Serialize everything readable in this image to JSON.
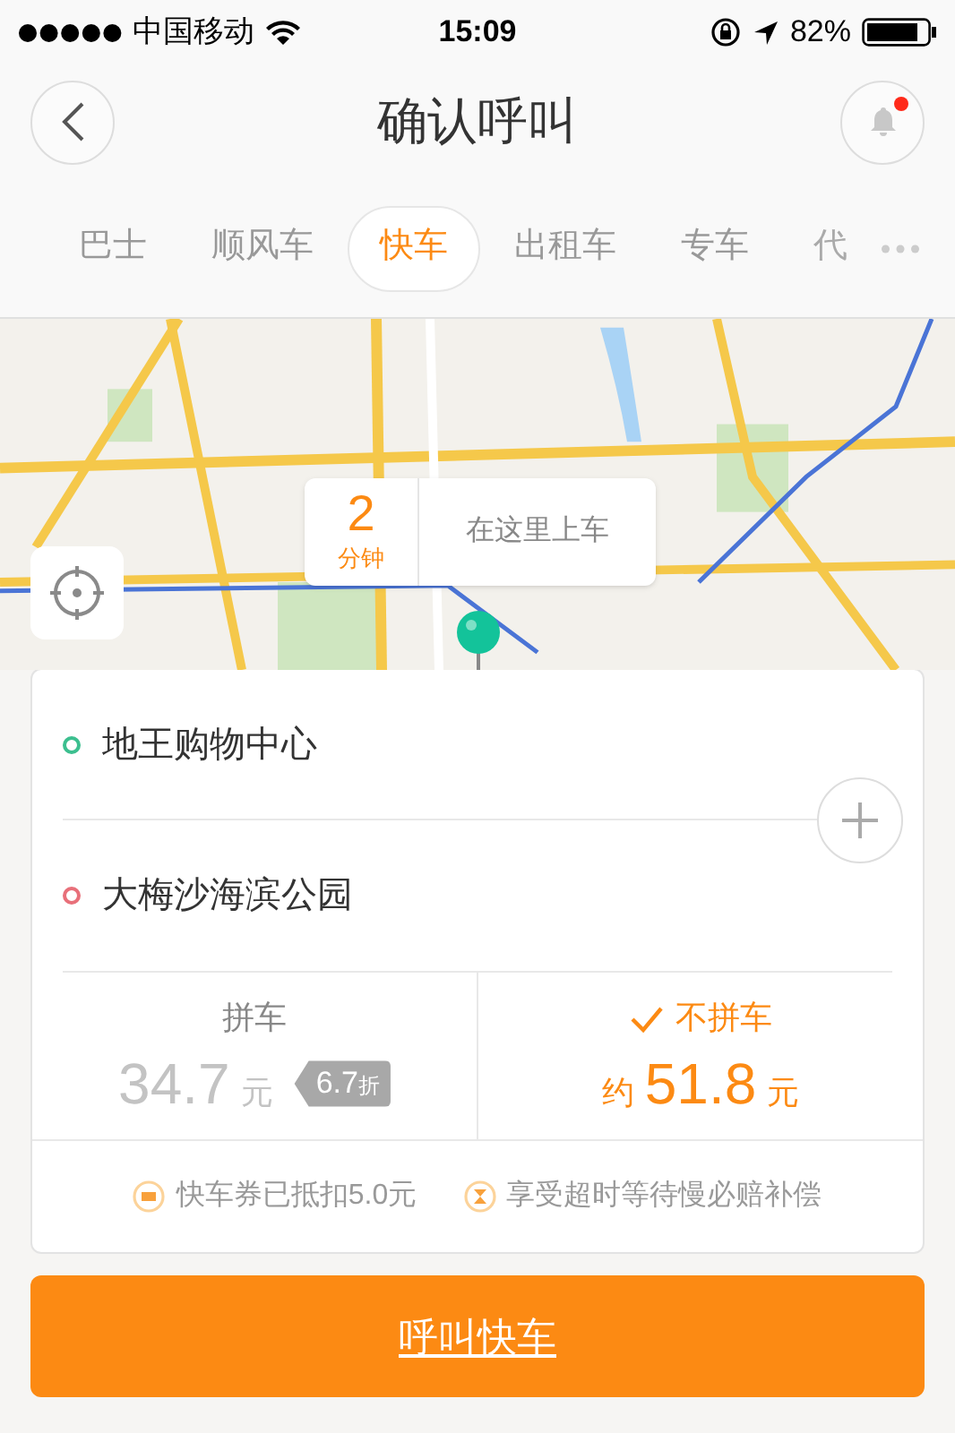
{
  "status_bar": {
    "signal_carrier": "中国移动",
    "time": "15:09",
    "battery": "82%"
  },
  "header": {
    "title": "确认呼叫",
    "notification_unread": true
  },
  "tabs": [
    {
      "label": "巴士",
      "selected": false
    },
    {
      "label": "顺风车",
      "selected": false
    },
    {
      "label": "快车",
      "selected": true
    },
    {
      "label": "出租车",
      "selected": false
    },
    {
      "label": "专车",
      "selected": false
    },
    {
      "label": "代",
      "selected": false
    }
  ],
  "map": {
    "kind": "picture",
    "pickup": {
      "eta": "2",
      "eta_unit": "分钟",
      "label": "在这里上车"
    }
  },
  "route": [
    {
      "kind": "origin",
      "text": "地王购物中心"
    },
    {
      "kind": "destination",
      "text": "大梅沙海滨公园"
    }
  ],
  "fares": [
    {
      "title": "拼车",
      "price": "34.7",
      "unit": "元",
      "discount": "6.7",
      "discount_unit": "折",
      "selected": false
    },
    {
      "title": "不拼车",
      "prefix": "约",
      "price": "51.8",
      "unit": "元",
      "selected": true
    }
  ],
  "notices": [
    {
      "kind": "coupon",
      "text": "快车券已抵扣5.0元"
    },
    {
      "kind": "timer",
      "text": "享受超时等待慢必赔补偿"
    }
  ],
  "primary_button": "呼叫快车"
}
